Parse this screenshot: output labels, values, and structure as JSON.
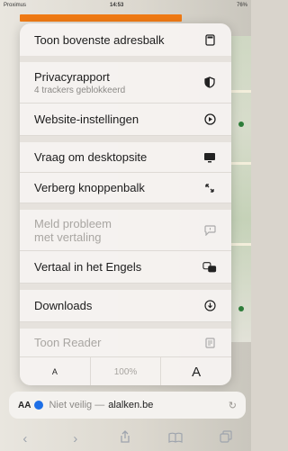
{
  "status": {
    "carrier": "Proximus",
    "time": "14:53",
    "battery": "76%"
  },
  "menu": {
    "show_top_address_bar": "Toon bovenste adresbalk",
    "privacy_report": "Privacyrapport",
    "privacy_sub": "4 trackers geblokkeerd",
    "website_settings": "Website-instellingen",
    "request_desktop_site": "Vraag om desktopsite",
    "hide_toolbar": "Verberg knoppenbalk",
    "report_translation_issue": "Meld probleem",
    "report_translation_issue_sub": "met vertaling",
    "translate_english": "Vertaal in het Engels",
    "downloads": "Downloads",
    "show_reader": "Toon Reader",
    "zoom_out": "A",
    "zoom_level": "100%",
    "zoom_in": "A"
  },
  "address": {
    "aa": "AA",
    "not_safe": "Niet veilig —",
    "domain": "alalken.be"
  },
  "icons": {
    "address_bar": "address-bar-icon",
    "privacy": "shield-half-icon",
    "settings": "gear-circle-icon",
    "desktop": "monitor-icon",
    "hide_toolbar": "diagonal-arrows-icon",
    "report": "speech-bubble-icon",
    "translate": "translate-icon",
    "downloads": "download-circle-icon",
    "reader": "reader-icon"
  },
  "colors": {
    "accent_orange": "#f07a14",
    "shield_blue": "#1e6fe6"
  }
}
